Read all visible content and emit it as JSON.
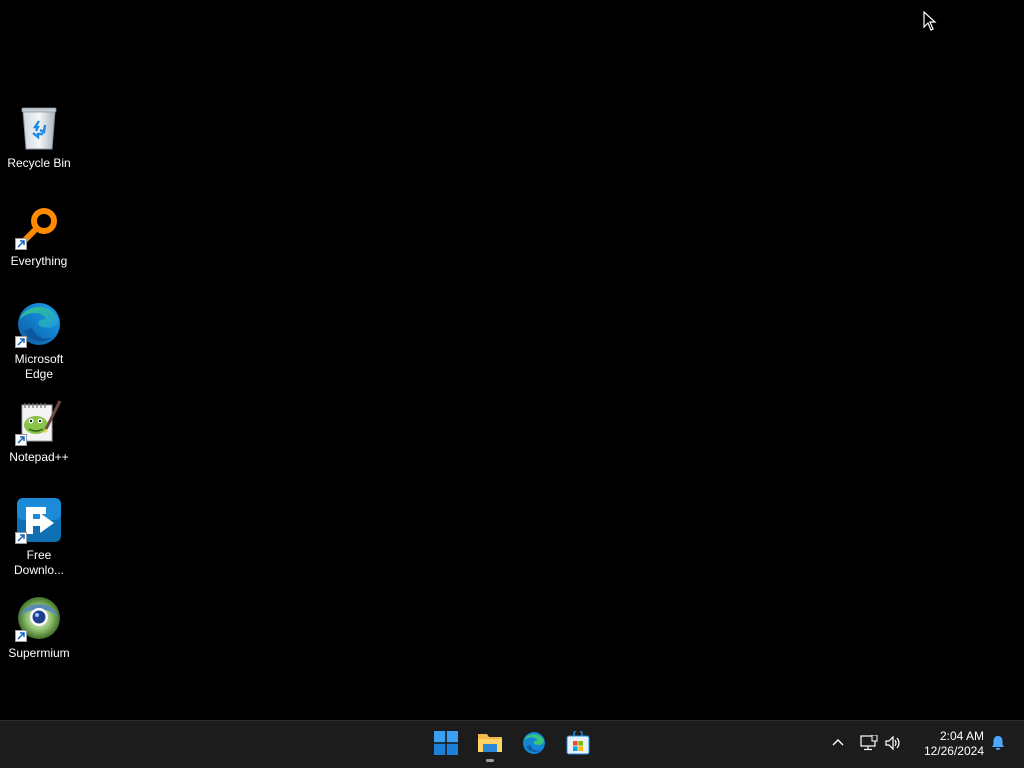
{
  "desktop": {
    "background_color": "#000000",
    "icons": [
      {
        "label": "Recycle Bin",
        "icon": "recycle-bin-icon"
      },
      {
        "label": "Everything",
        "icon": "everything-search-icon",
        "shortcut": true
      },
      {
        "label": "Microsoft Edge",
        "icon": "edge-icon",
        "shortcut": true
      },
      {
        "label": "Notepad++",
        "icon": "notepad-plus-plus-icon",
        "shortcut": true
      },
      {
        "label": "Free Downlo...",
        "icon": "free-download-manager-icon",
        "shortcut": true
      },
      {
        "label": "Supermium",
        "icon": "supermium-icon",
        "shortcut": true
      }
    ]
  },
  "taskbar": {
    "background_color": "#1c1c1c",
    "apps": [
      {
        "name": "Start",
        "icon": "windows-start-icon"
      },
      {
        "name": "File Explorer",
        "icon": "file-explorer-icon",
        "running": true
      },
      {
        "name": "Microsoft Edge",
        "icon": "edge-icon"
      },
      {
        "name": "Microsoft Store",
        "icon": "store-icon"
      }
    ],
    "tray": {
      "icons": [
        "chevron-up-icon",
        "network-icon",
        "volume-icon",
        "notification-bell-icon"
      ],
      "time": "2:04 AM",
      "date": "12/26/2024"
    }
  }
}
